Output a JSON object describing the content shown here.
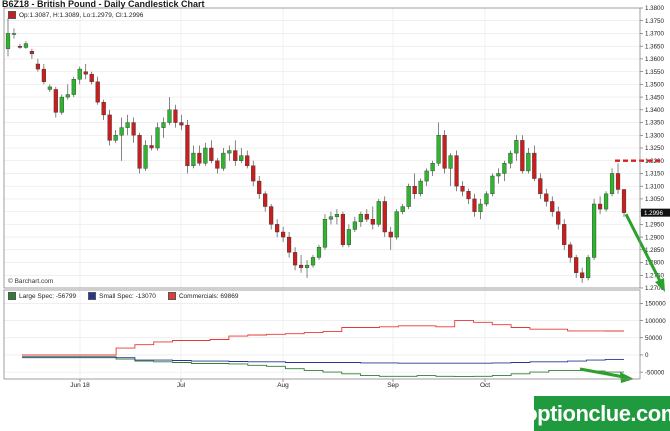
{
  "chart": {
    "title": "B6Z18 - British Pound - Daily Candlestick Chart",
    "ohlc_label": "Op:1.3087, H:1.3089, Lo:1.2979, Cl:1.2996",
    "credit": "© Barchart.com",
    "last_price_label": "1.2996",
    "cot_legend": [
      {
        "label": "Large Spec: -56799",
        "color": "#2e7d32"
      },
      {
        "label": "Small Spec: -13070",
        "color": "#1a237e"
      },
      {
        "label": "Commercials: 69869",
        "color": "#c62828"
      }
    ],
    "watermark": "optionclue.com",
    "colors": {
      "up": "#2db52d",
      "down": "#c81e1e",
      "large_spec": "#2e7d32",
      "small_spec": "#283593",
      "commercials": "#e53935",
      "arrow": "#2ca02c",
      "resistance": "#d62020"
    }
  },
  "chart_data": [
    {
      "type": "candlestick",
      "title": "B6Z18 - British Pound - Daily Candlestick Chart",
      "x_tick_labels": [
        "Jun 18",
        "Jul",
        "Aug",
        "Sep",
        "Oct"
      ],
      "y_tick_labels": [
        "1.3800",
        "1.3750",
        "1.3700",
        "1.3650",
        "1.3600",
        "1.3550",
        "1.3500",
        "1.3450",
        "1.3400",
        "1.3350",
        "1.3300",
        "1.3250",
        "1.3200",
        "1.3150",
        "1.3100",
        "1.3050",
        "1.3000",
        "1.2950",
        "1.2900",
        "1.2850",
        "1.2800",
        "1.2750",
        "1.2700"
      ],
      "ylim": [
        1.27,
        1.38
      ],
      "candles": [
        [
          1.364,
          1.376,
          1.361,
          1.37
        ],
        [
          1.37,
          1.372,
          1.368,
          1.37
        ],
        [
          1.365,
          1.366,
          1.364,
          1.3645
        ],
        [
          1.3645,
          1.367,
          1.364,
          1.366
        ],
        [
          1.363,
          1.364,
          1.36,
          1.362
        ],
        [
          1.358,
          1.36,
          1.355,
          1.356
        ],
        [
          1.356,
          1.358,
          1.35,
          1.351
        ],
        [
          1.348,
          1.35,
          1.347,
          1.349
        ],
        [
          1.348,
          1.349,
          1.337,
          1.339
        ],
        [
          1.339,
          1.346,
          1.338,
          1.345
        ],
        [
          1.345,
          1.35,
          1.344,
          1.346
        ],
        [
          1.346,
          1.353,
          1.345,
          1.352
        ],
        [
          1.352,
          1.357,
          1.35,
          1.356
        ],
        [
          1.355,
          1.358,
          1.352,
          1.354
        ],
        [
          1.354,
          1.355,
          1.35,
          1.351
        ],
        [
          1.351,
          1.353,
          1.342,
          1.343
        ],
        [
          1.343,
          1.344,
          1.336,
          1.338
        ],
        [
          1.338,
          1.34,
          1.326,
          1.328
        ],
        [
          1.328,
          1.332,
          1.327,
          1.33
        ],
        [
          1.33,
          1.337,
          1.32,
          1.333
        ],
        [
          1.333,
          1.338,
          1.33,
          1.335
        ],
        [
          1.335,
          1.337,
          1.327,
          1.33
        ],
        [
          1.33,
          1.331,
          1.315,
          1.317
        ],
        [
          1.317,
          1.328,
          1.316,
          1.326
        ],
        [
          1.326,
          1.33,
          1.324,
          1.325
        ],
        [
          1.325,
          1.335,
          1.324,
          1.333
        ],
        [
          1.333,
          1.337,
          1.329,
          1.335
        ],
        [
          1.335,
          1.345,
          1.334,
          1.34
        ],
        [
          1.34,
          1.342,
          1.333,
          1.335
        ],
        [
          1.335,
          1.338,
          1.332,
          1.334
        ],
        [
          1.334,
          1.336,
          1.315,
          1.318
        ],
        [
          1.318,
          1.326,
          1.317,
          1.323
        ],
        [
          1.323,
          1.326,
          1.318,
          1.319
        ],
        [
          1.319,
          1.327,
          1.318,
          1.325
        ],
        [
          1.325,
          1.328,
          1.319,
          1.32
        ],
        [
          1.32,
          1.321,
          1.315,
          1.317
        ],
        [
          1.317,
          1.325,
          1.316,
          1.323
        ],
        [
          1.323,
          1.326,
          1.32,
          1.324
        ],
        [
          1.324,
          1.328,
          1.318,
          1.32
        ],
        [
          1.32,
          1.325,
          1.319,
          1.322
        ],
        [
          1.322,
          1.324,
          1.317,
          1.318
        ],
        [
          1.318,
          1.32,
          1.31,
          1.312
        ],
        [
          1.312,
          1.314,
          1.305,
          1.307
        ],
        [
          1.307,
          1.308,
          1.3,
          1.302
        ],
        [
          1.302,
          1.303,
          1.293,
          1.295
        ],
        [
          1.295,
          1.297,
          1.29,
          1.292
        ],
        [
          1.292,
          1.294,
          1.288,
          1.29
        ],
        [
          1.29,
          1.292,
          1.282,
          1.284
        ],
        [
          1.284,
          1.286,
          1.277,
          1.279
        ],
        [
          1.279,
          1.283,
          1.276,
          1.278
        ],
        [
          1.278,
          1.281,
          1.274,
          1.279
        ],
        [
          1.279,
          1.283,
          1.278,
          1.282
        ],
        [
          1.282,
          1.287,
          1.281,
          1.286
        ],
        [
          1.286,
          1.299,
          1.285,
          1.297
        ],
        [
          1.297,
          1.3,
          1.295,
          1.298
        ],
        [
          1.298,
          1.301,
          1.295,
          1.299
        ],
        [
          1.299,
          1.3,
          1.286,
          1.287
        ],
        [
          1.287,
          1.295,
          1.286,
          1.293
        ],
        [
          1.293,
          1.298,
          1.292,
          1.296
        ],
        [
          1.296,
          1.3,
          1.294,
          1.299
        ],
        [
          1.299,
          1.301,
          1.296,
          1.297
        ],
        [
          1.297,
          1.302,
          1.293,
          1.295
        ],
        [
          1.295,
          1.305,
          1.294,
          1.304
        ],
        [
          1.304,
          1.306,
          1.29,
          1.292
        ],
        [
          1.292,
          1.294,
          1.285,
          1.29
        ],
        [
          1.29,
          1.301,
          1.289,
          1.3
        ],
        [
          1.3,
          1.303,
          1.299,
          1.302
        ],
        [
          1.302,
          1.311,
          1.301,
          1.31
        ],
        [
          1.31,
          1.315,
          1.305,
          1.307
        ],
        [
          1.307,
          1.313,
          1.306,
          1.312
        ],
        [
          1.312,
          1.317,
          1.31,
          1.316
        ],
        [
          1.316,
          1.32,
          1.314,
          1.319
        ],
        [
          1.319,
          1.335,
          1.318,
          1.33
        ],
        [
          1.33,
          1.332,
          1.315,
          1.317
        ],
        [
          1.317,
          1.323,
          1.31,
          1.322
        ],
        [
          1.322,
          1.324,
          1.308,
          1.31
        ],
        [
          1.31,
          1.312,
          1.306,
          1.308
        ],
        [
          1.308,
          1.309,
          1.303,
          1.305
        ],
        [
          1.305,
          1.307,
          1.298,
          1.3
        ],
        [
          1.3,
          1.305,
          1.297,
          1.303
        ],
        [
          1.303,
          1.308,
          1.302,
          1.307
        ],
        [
          1.307,
          1.315,
          1.306,
          1.314
        ],
        [
          1.314,
          1.317,
          1.311,
          1.315
        ],
        [
          1.315,
          1.32,
          1.312,
          1.319
        ],
        [
          1.319,
          1.324,
          1.317,
          1.323
        ],
        [
          1.323,
          1.33,
          1.32,
          1.328
        ],
        [
          1.328,
          1.33,
          1.315,
          1.316
        ],
        [
          1.316,
          1.325,
          1.315,
          1.323
        ],
        [
          1.323,
          1.326,
          1.312,
          1.313
        ],
        [
          1.313,
          1.315,
          1.305,
          1.307
        ],
        [
          1.307,
          1.309,
          1.302,
          1.304
        ],
        [
          1.304,
          1.306,
          1.298,
          1.3
        ],
        [
          1.3,
          1.302,
          1.293,
          1.295
        ],
        [
          1.295,
          1.297,
          1.285,
          1.287
        ],
        [
          1.287,
          1.288,
          1.28,
          1.282
        ],
        [
          1.282,
          1.283,
          1.274,
          1.276
        ],
        [
          1.276,
          1.278,
          1.272,
          1.274
        ],
        [
          1.274,
          1.283,
          1.273,
          1.282
        ],
        [
          1.282,
          1.305,
          1.281,
          1.303
        ],
        [
          1.303,
          1.306,
          1.299,
          1.301
        ],
        [
          1.301,
          1.308,
          1.3,
          1.307
        ],
        [
          1.307,
          1.317,
          1.306,
          1.315
        ],
        [
          1.315,
          1.319,
          1.307,
          1.3087
        ],
        [
          1.3087,
          1.3089,
          1.2979,
          1.2996
        ]
      ]
    },
    {
      "type": "line",
      "title": "Commitment of Traders",
      "series": [
        {
          "name": "Large Spec",
          "values": [
            -5000,
            -5000,
            -5000,
            -5000,
            -5000,
            -12000,
            -18000,
            -20000,
            -22000,
            -25000,
            -25000,
            -26000,
            -30000,
            -33000,
            -40000,
            -45000,
            -50000,
            -55000,
            -60000,
            -62000,
            -62000,
            -60000,
            -62000,
            -63000,
            -62000,
            -60000,
            -55000,
            -50000,
            -45000,
            -45000,
            -47000,
            -50000
          ]
        },
        {
          "name": "Small Spec",
          "values": [
            -8000,
            -8000,
            -8000,
            -8000,
            -8000,
            -8000,
            -15000,
            -15000,
            -16000,
            -18000,
            -18000,
            -19000,
            -20000,
            -20000,
            -22000,
            -22000,
            -22000,
            -22000,
            -23000,
            -23000,
            -24000,
            -24000,
            -24000,
            -24000,
            -24000,
            -23000,
            -22000,
            -20000,
            -20000,
            -18000,
            -15000,
            -13070
          ]
        },
        {
          "name": "Commercials",
          "values": [
            0,
            0,
            0,
            0,
            0,
            20000,
            30000,
            38000,
            42000,
            42000,
            45000,
            55000,
            58000,
            60000,
            62000,
            65000,
            68000,
            80000,
            80000,
            82000,
            85000,
            85000,
            82000,
            100000,
            95000,
            88000,
            80000,
            75000,
            75000,
            70000,
            70000,
            69869
          ]
        }
      ],
      "y_tick_labels": [
        "150000",
        "100000",
        "50000",
        "0",
        "-50000"
      ],
      "ylim": [
        -70000,
        160000
      ]
    }
  ]
}
